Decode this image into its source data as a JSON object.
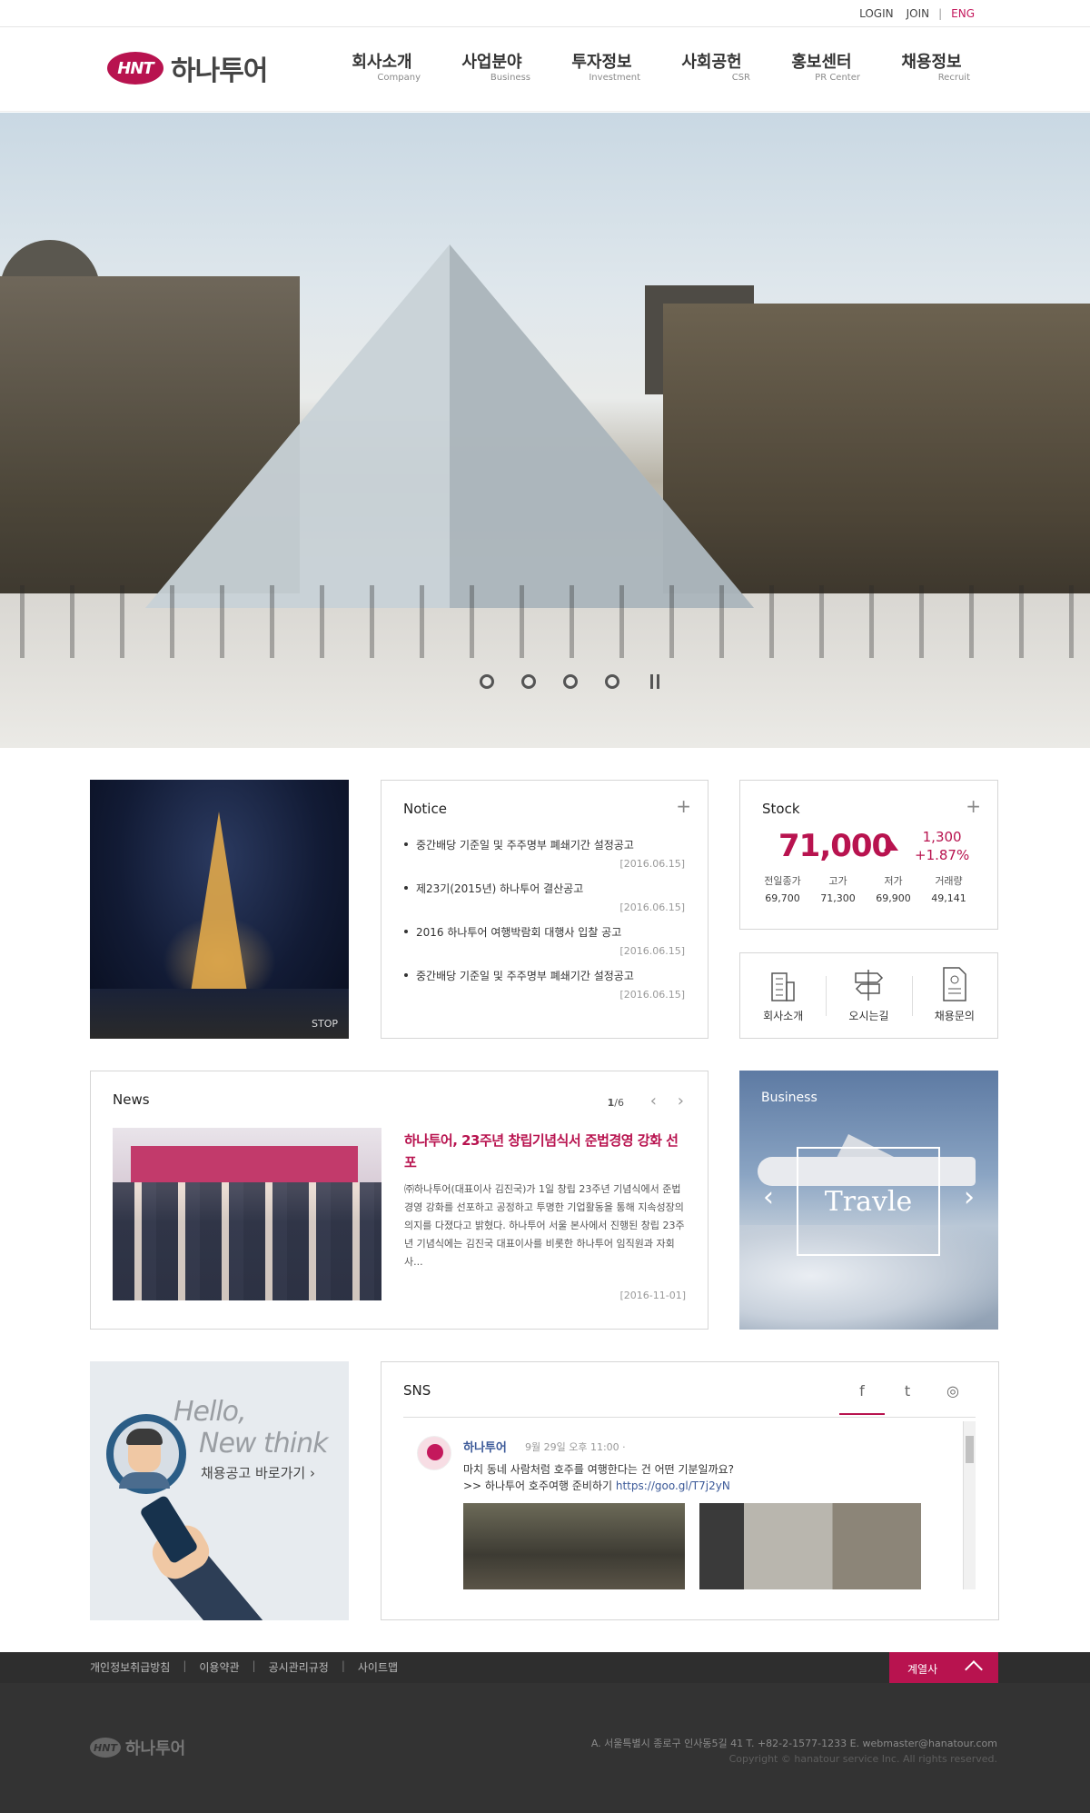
{
  "util": {
    "login": "LOGIN",
    "join": "JOIN",
    "sep": "|",
    "eng": "ENG"
  },
  "logo": {
    "badge": "HNT",
    "name": "하나투어"
  },
  "gnb": [
    {
      "ko": "회사소개",
      "en": "Company"
    },
    {
      "ko": "사업분야",
      "en": "Business"
    },
    {
      "ko": "투자정보",
      "en": "Investment"
    },
    {
      "ko": "사회공헌",
      "en": "CSR"
    },
    {
      "ko": "홍보센터",
      "en": "PR Center"
    },
    {
      "ko": "채용정보",
      "en": "Recruit"
    }
  ],
  "hero": {
    "slides": 4,
    "active": 0
  },
  "visual": {
    "stop": "STOP"
  },
  "notice": {
    "title": "Notice",
    "items": [
      {
        "text": "중간배당 기준일 및 주주명부 폐쇄기간 설정공고",
        "date": "[2016.06.15]"
      },
      {
        "text": "제23기(2015년) 하나투어 결산공고",
        "date": "[2016.06.15]"
      },
      {
        "text": "2016 하나투어 여행박람회 대행사 입찰 공고",
        "date": "[2016.06.15]"
      },
      {
        "text": "중간배당 기준일 및 주주명부 폐쇄기간 설정공고",
        "date": "[2016.06.15]"
      }
    ]
  },
  "stock": {
    "title": "Stock",
    "price": "71,000",
    "change": "1,300",
    "change_pct": "+1.87%",
    "cols": [
      {
        "label": "전일종가",
        "value": "69,700"
      },
      {
        "label": "고가",
        "value": "71,300"
      },
      {
        "label": "저가",
        "value": "69,900"
      },
      {
        "label": "거래량",
        "value": "49,141"
      }
    ]
  },
  "quick": [
    {
      "label": "회사소개",
      "icon": "building-icon"
    },
    {
      "label": "오시는길",
      "icon": "signpost-icon"
    },
    {
      "label": "채용문의",
      "icon": "document-icon"
    }
  ],
  "news": {
    "title": "News",
    "page": "1",
    "total": "/6",
    "headline": "하나투어, 23주년 창립기념식서 준법경영 강화 선포",
    "body": "㈜하나투어(대표이사 김진국)가 1일 창립 23주년 기념식에서 준법경영 강화를 선포하고 공정하고 투명한 기업활동을 통해 지속성장의 의지를 다졌다고 밝혔다. 하나투어 서울 본사에서 진행된 창립 23주년 기념식에는 김진국 대표이사를 비롯한 하나투어 임직원과 자회사...",
    "date": "[2016-11-01]"
  },
  "business": {
    "label": "Business",
    "frame_text": "Travle"
  },
  "recruit": {
    "hello_1": "Hello,",
    "hello_2": "New think",
    "link": "채용공고 바로가기"
  },
  "sns": {
    "title": "SNS",
    "tabs": [
      "f",
      "t",
      "◎"
    ],
    "post": {
      "author": "하나투어",
      "time": "9월 29일 오후 11:00 ·",
      "line1": "마치 동네 사람처럼 호주를 여행한다는 건 어떤 기분일까요?",
      "line2_prefix": ">> 하나투어 호주여행 준비하기",
      "line2_url": "https://goo.gl/T7j2yN"
    }
  },
  "footer": {
    "links": [
      "개인정보취급방침",
      "이용약관",
      "공시관리규정",
      "사이트맵"
    ],
    "family": "계열사",
    "logo_badge": "HNT",
    "logo_name": "하나투어",
    "address": "A. 서울특별시 종로구 인사동5길 41 T. +82-2-1577-1233 E. webmaster@hanatour.com",
    "copyright": "Copyright © hanatour service Inc. All rights reserved."
  },
  "colors": {
    "brand": "#b8134f",
    "footer_bg": "#333333"
  }
}
